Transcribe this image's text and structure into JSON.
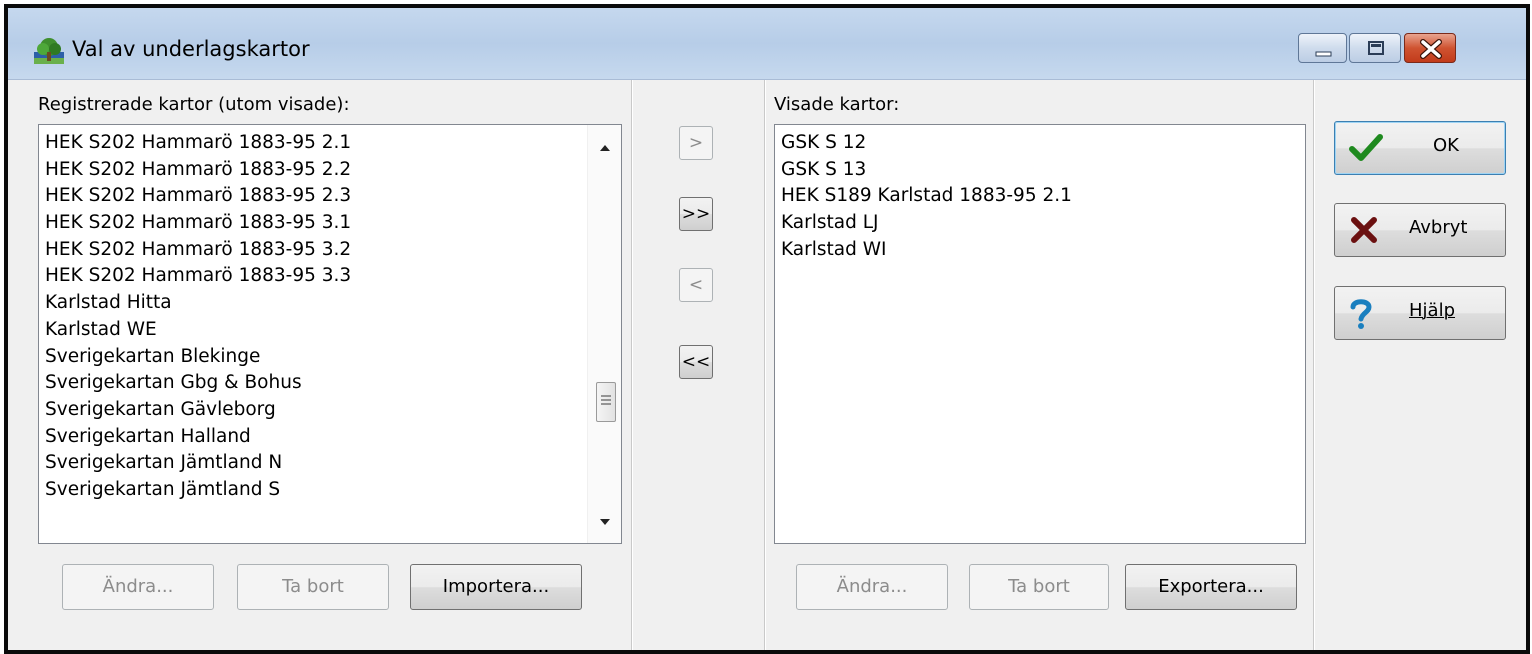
{
  "window": {
    "title": "Val av underlagskartor",
    "controls": {
      "minimize": "minimize",
      "maximize": "maximize",
      "close": "close"
    }
  },
  "left_panel": {
    "label": "Registrerade kartor (utom visade):",
    "items": [
      "HEK S202 Hammarö 1883-95 2.1",
      "HEK S202 Hammarö 1883-95 2.2",
      "HEK S202 Hammarö 1883-95 2.3",
      "HEK S202 Hammarö 1883-95 3.1",
      "HEK S202 Hammarö 1883-95 3.2",
      "HEK S202 Hammarö 1883-95 3.3",
      "Karlstad Hitta",
      "Karlstad WE",
      "Sverigekartan Blekinge",
      "Sverigekartan Gbg & Bohus",
      "Sverigekartan Gävleborg",
      "Sverigekartan Halland",
      "Sverigekartan Jämtland N",
      "Sverigekartan Jämtland S"
    ],
    "buttons": {
      "edit": "Ändra...",
      "remove": "Ta bort",
      "import": "Importera..."
    }
  },
  "transfer": {
    "add_one": ">",
    "add_all": ">>",
    "remove_one": "<",
    "remove_all": "<<"
  },
  "right_panel": {
    "label": "Visade kartor:",
    "items": [
      "GSK S 12",
      "GSK S 13",
      "HEK S189 Karlstad 1883-95 2.1",
      "Karlstad LJ",
      "Karlstad WI"
    ],
    "buttons": {
      "edit": "Ändra...",
      "remove": "Ta bort",
      "export": "Exportera..."
    }
  },
  "actions": {
    "ok": "OK",
    "cancel": "Avbryt",
    "help": "Hjälp"
  },
  "colors": {
    "ok_check": "#1f8a1f",
    "cancel_x": "#6b1010",
    "help_q": "#1a7fbf"
  },
  "icons": {
    "app": "tree-map-icon",
    "ok": "check-icon",
    "cancel": "x-icon",
    "help": "question-icon"
  }
}
